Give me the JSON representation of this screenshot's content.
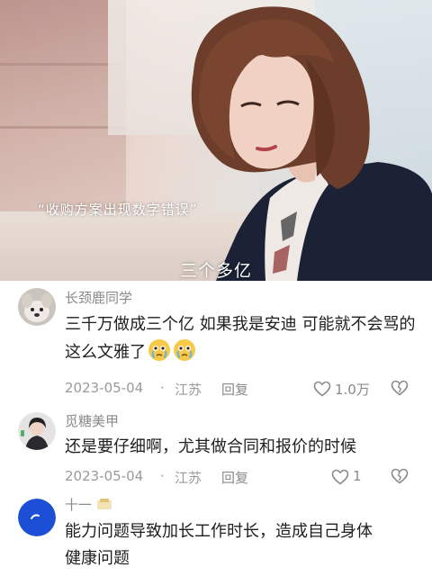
{
  "video": {
    "caption_quote": "“收购方案出现数字错误”",
    "subtitle": "三个多亿"
  },
  "comments": [
    {
      "username": "长颈鹿同学",
      "text": "三千万做成三个亿 如果我是安迪 可能就不会骂的这么文雅了",
      "emoji_count": 2,
      "date": "2023-05-04",
      "separator": "·",
      "location": "江苏",
      "reply_label": "回复",
      "likes": "1.0万"
    },
    {
      "username": "觅糖美甲",
      "text": "还是要仔细啊，尤其做合同和报价的时候",
      "date": "2023-05-04",
      "separator": "·",
      "location": "江苏",
      "reply_label": "回复",
      "likes": "1"
    },
    {
      "username": "十一",
      "text_line1": "能力问题导致加长工作时长，造成自己身体",
      "text_line2": "健康问题"
    }
  ],
  "colors": {
    "meta_gray": "#9a9a9a",
    "avatar3_blue": "#1d4fd6"
  }
}
